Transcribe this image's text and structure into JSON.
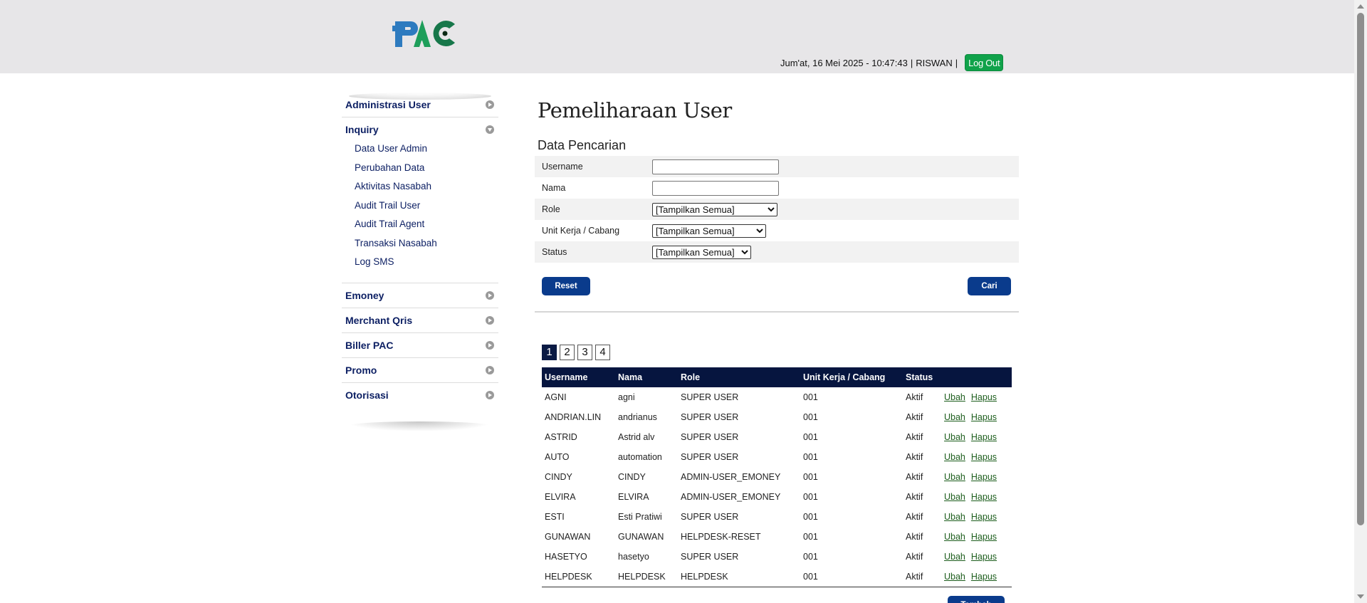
{
  "header": {
    "logo_text": "PAC",
    "datetime": "Jum'at, 16 Mei 2025 - 10:47:43",
    "separator": "|",
    "username": "RISWAN",
    "logout_label": "Log Out",
    "logo_colors": {
      "blue": "#2e7bbf",
      "green": "#1e9e5a",
      "dark_green": "#17774a"
    }
  },
  "sidebar": {
    "groups": [
      {
        "label": "Administrasi User",
        "expanded": false
      },
      {
        "label": "Inquiry",
        "expanded": true,
        "items": [
          "Data User Admin",
          "Perubahan Data",
          "Aktivitas Nasabah",
          "Audit Trail User",
          "Audit Trail Agent",
          "Transaksi Nasabah",
          "Log SMS"
        ]
      },
      {
        "label": "Emoney",
        "expanded": false
      },
      {
        "label": "Merchant Qris",
        "expanded": false
      },
      {
        "label": "Biller PAC",
        "expanded": false
      },
      {
        "label": "Promo",
        "expanded": false
      },
      {
        "label": "Otorisasi",
        "expanded": false
      }
    ]
  },
  "main": {
    "title": "Pemeliharaan User",
    "search_title": "Data Pencarian",
    "fields": {
      "username": {
        "label": "Username",
        "value": ""
      },
      "nama": {
        "label": "Nama",
        "value": ""
      },
      "role": {
        "label": "Role",
        "selected": "[Tampilkan Semua]"
      },
      "unit": {
        "label": "Unit Kerja / Cabang",
        "selected": "[Tampilkan Semua]"
      },
      "status": {
        "label": "Status",
        "selected": "[Tampilkan Semua]"
      }
    },
    "reset_label": "Reset",
    "cari_label": "Cari",
    "pages": [
      "1",
      "2",
      "3",
      "4"
    ],
    "active_page": "1",
    "table": {
      "headers": [
        "Username",
        "Nama",
        "Role",
        "Unit Kerja / Cabang",
        "Status",
        ""
      ],
      "edit_label": "Ubah",
      "delete_label": "Hapus",
      "rows": [
        [
          "AGNI",
          "agni",
          "SUPER USER",
          "001",
          "Aktif"
        ],
        [
          "ANDRIAN.LIN",
          "andrianus",
          "SUPER USER",
          "001",
          "Aktif"
        ],
        [
          "ASTRID",
          "Astrid alv",
          "SUPER USER",
          "001",
          "Aktif"
        ],
        [
          "AUTO",
          "automation",
          "SUPER USER",
          "001",
          "Aktif"
        ],
        [
          "CINDY",
          "CINDY",
          "ADMIN-USER_EMONEY",
          "001",
          "Aktif"
        ],
        [
          "ELVIRA",
          "ELVIRA",
          "ADMIN-USER_EMONEY",
          "001",
          "Aktif"
        ],
        [
          "ESTI",
          "Esti Pratiwi",
          "SUPER USER",
          "001",
          "Aktif"
        ],
        [
          "GUNAWAN",
          "GUNAWAN",
          "HELPDESK-RESET",
          "001",
          "Aktif"
        ],
        [
          "HASETYO",
          "hasetyo",
          "SUPER USER",
          "001",
          "Aktif"
        ],
        [
          "HELPDESK",
          "HELPDESK",
          "HELPDESK",
          "001",
          "Aktif"
        ]
      ]
    },
    "tambah_label": "Tambah"
  }
}
